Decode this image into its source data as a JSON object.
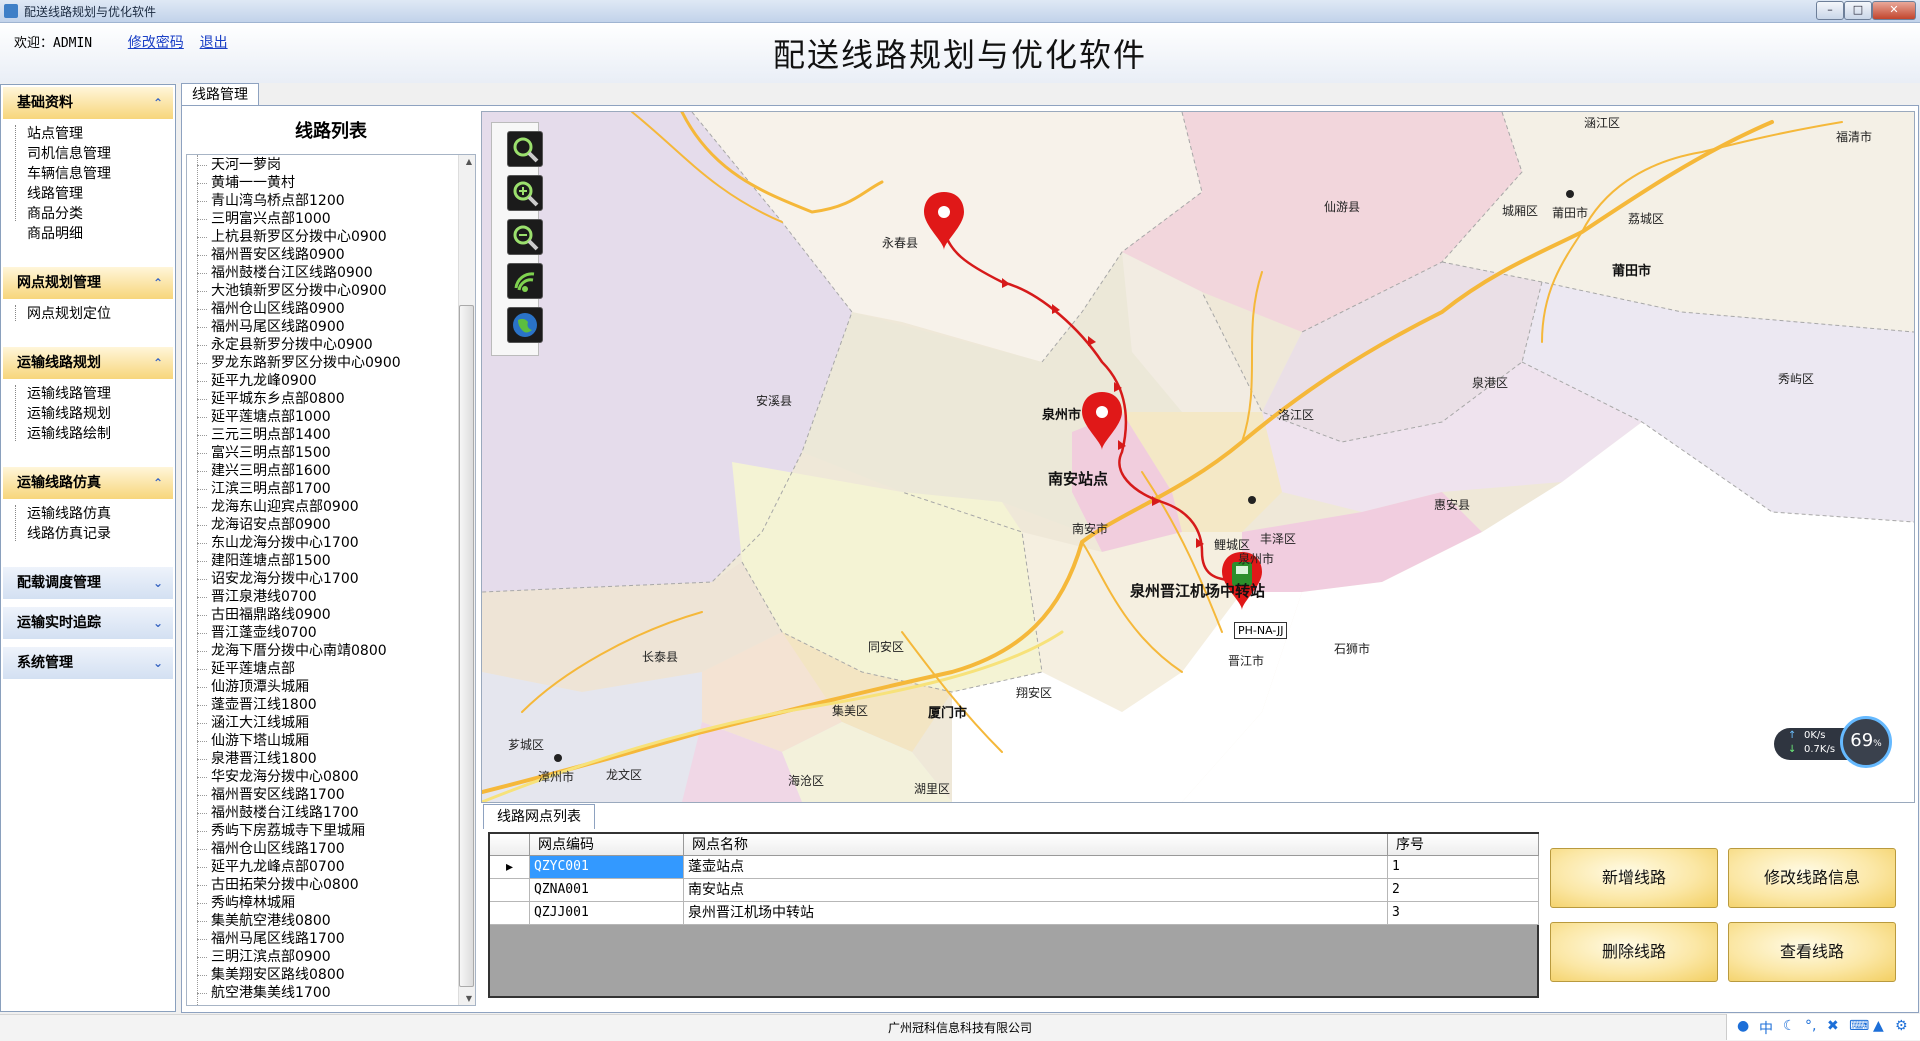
{
  "window": {
    "title": "配送线路规划与优化软件"
  },
  "header": {
    "welcome": "欢迎：ADMIN",
    "change_password": "修改密码",
    "logout": "退出",
    "app_title": "配送线路规划与优化软件"
  },
  "sidebar": {
    "sections": [
      {
        "title": "基础资料",
        "items": [
          "站点管理",
          "司机信息管理",
          "车辆信息管理",
          "线路管理",
          "商品分类",
          "商品明细"
        ]
      },
      {
        "title": "网点规划管理",
        "items": [
          "网点规划定位"
        ]
      },
      {
        "title": "运输线路规划",
        "items": [
          "运输线路管理",
          "运输线路规划",
          "运输线路绘制"
        ]
      },
      {
        "title": "运输线路仿真",
        "items": [
          "运输线路仿真",
          "线路仿真记录"
        ]
      },
      {
        "title": "配载调度管理",
        "items": []
      },
      {
        "title": "运输实时追踪",
        "items": []
      },
      {
        "title": "系统管理",
        "items": []
      }
    ]
  },
  "tabs": {
    "main": "线路管理",
    "points": "线路网点列表"
  },
  "route_list": {
    "title": "线路列表",
    "items": [
      "天河一萝岗",
      "黄埔一一黄村",
      "青山湾乌桥点部1200",
      "三明富兴点部1000",
      "上杭县新罗区分拨中心0900",
      "福州晋安区线路0900",
      "福州鼓楼台江区线路0900",
      "大池镇新罗区分拨中心0900",
      "福州仓山区线路0900",
      "福州马尾区线路0900",
      "永定县新罗分拨中心0900",
      "罗龙东路新罗区分拨中心0900",
      "延平九龙峰0900",
      "延平城东乡点部0800",
      "延平莲塘点部1000",
      "三元三明点部1400",
      "富兴三明点部1500",
      "建兴三明点部1600",
      "江滨三明点部1700",
      "龙海东山迎宾点部0900",
      "龙海诏安点部0900",
      "东山龙海分拨中心1700",
      "建阳莲塘点部1500",
      "诏安龙海分拨中心1700",
      "晋江泉港线0700",
      "古田福鼎路线0900",
      "晋江蓬壶线0700",
      "龙海下厝分拨中心南靖0800",
      "延平莲塘点部",
      "仙游顶潭头城厢",
      "蓬壶晋江线1800",
      "涵江大江线城厢",
      "仙游下塔山城厢",
      "泉港晋江线1800",
      "华安龙海分拨中心0800",
      "福州晋安区线路1700",
      "福州鼓楼台江线路1700",
      "秀屿下房荔城寺下里城厢",
      "福州仓山区线路1700",
      "延平九龙峰点部0700",
      "古田拓荣分拨中心0800",
      "秀屿樟林城厢",
      "集美航空港线0800",
      "福州马尾区线路1700",
      "三明江滨点部0900",
      "集美翔安区路线0800",
      "航空港集美线1700"
    ]
  },
  "map": {
    "labels": {
      "hanjiang": "涵江区",
      "fuqing": "福清市",
      "xianyou": "仙游县",
      "chengxiang": "城厢区",
      "putian1": "莆田市",
      "licheng_pt": "荔城区",
      "putian2": "莆田市",
      "yongchun": "永春县",
      "anxi": "安溪县",
      "quanzhou": "泉州市",
      "quangang": "泉港区",
      "xiuyu": "秀屿区",
      "luojiang": "洛江区",
      "huian": "惠安县",
      "nanan_stop": "南安站点",
      "nanan": "南安市",
      "licheng": "鲤城区",
      "fengze": "丰泽区",
      "quanzhou2": "泉州市",
      "jinjiang_hub": "泉州晋江机场中转站",
      "jinjiang": "晋江市",
      "shishi": "石狮市",
      "tongan": "同安区",
      "changtai": "长泰县",
      "jimei": "集美区",
      "xiamen": "厦门市",
      "xiangan": "翔安区",
      "zhangzhou": "漳州市",
      "longwen": "龙文区",
      "xiangcheng": "芗城区",
      "haicang": "海沧区",
      "huli": "湖里区"
    },
    "vehicle_tag": "PH-NA-JJ",
    "net_widget": {
      "upload": "0K/s",
      "download": "0.7K/s",
      "percent": "69"
    }
  },
  "points_grid": {
    "columns": [
      "网点编码",
      "网点名称",
      "序号"
    ],
    "rows": [
      {
        "code": "QZYC001",
        "name": "蓬壶站点",
        "seq": "1"
      },
      {
        "code": "QZNA001",
        "name": "南安站点",
        "seq": "2"
      },
      {
        "code": "QZJJ001",
        "name": "泉州晋江机场中转站",
        "seq": "3"
      }
    ]
  },
  "buttons": {
    "add": "新增线路",
    "edit": "修改线路信息",
    "delete": "删除线路",
    "view": "查看线路"
  },
  "footer": {
    "company": "广州冠科信息科技有限公司"
  },
  "colors": {
    "accent_nav": "#f7d67b",
    "route_line": "#d61a1a",
    "button_gold": "#f3cf62",
    "selection": "#3399ff"
  }
}
